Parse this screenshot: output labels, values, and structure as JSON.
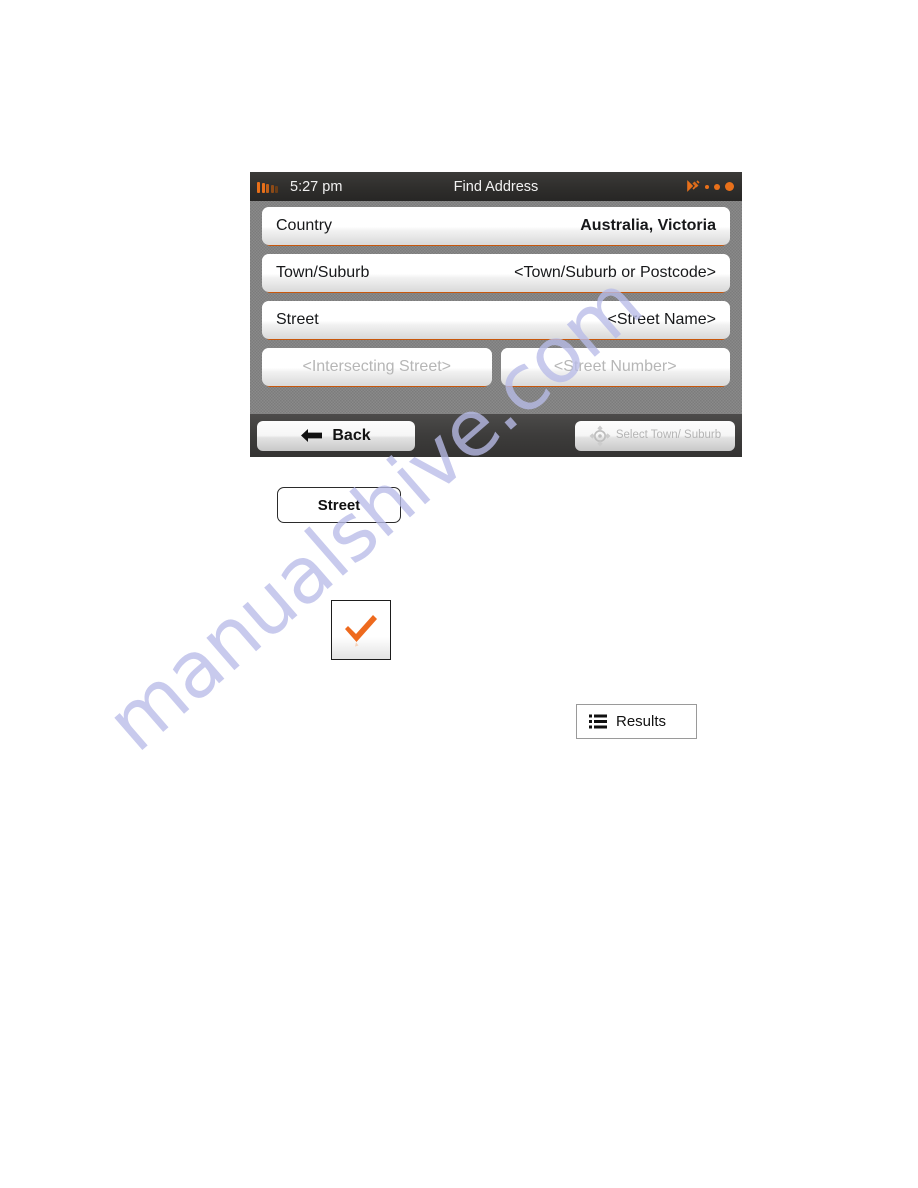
{
  "watermark": {
    "text": "manualshive.com",
    "color": "#b9bce8"
  },
  "device": {
    "statusbar": {
      "battery_icon": "battery-icon",
      "clock": "5:27 pm",
      "title": "Find Address",
      "satellite_icon": "satellite-icon",
      "signal_dots": [
        "signal-dot-small",
        "signal-dot-medium",
        "signal-dot-large"
      ]
    },
    "fields": [
      {
        "label": "Country",
        "value": "Australia, Victoria",
        "bold": true,
        "disabled": false
      },
      {
        "label": "Town/Suburb",
        "value": "<Town/Suburb or Postcode>",
        "bold": false,
        "disabled": false
      },
      {
        "label": "Street",
        "value": "<Street Name>",
        "bold": false,
        "disabled": false
      }
    ],
    "pair_fields": [
      {
        "value": "<Intersecting Street>",
        "disabled": true
      },
      {
        "value": "<Street Number>",
        "disabled": true
      }
    ],
    "bottombar": {
      "back_label": "Back",
      "back_icon": "arrow-left-icon",
      "select_label": "Select Town/ Suburb",
      "select_icon": "crosshair-icon",
      "select_disabled": true
    },
    "accent_color": "#e8701a"
  },
  "doc_buttons": {
    "street": {
      "label": "Street"
    },
    "check": {
      "icon": "check-icon",
      "color": "#ee6a1e"
    },
    "results": {
      "label": "Results",
      "icon": "list-icon"
    }
  }
}
